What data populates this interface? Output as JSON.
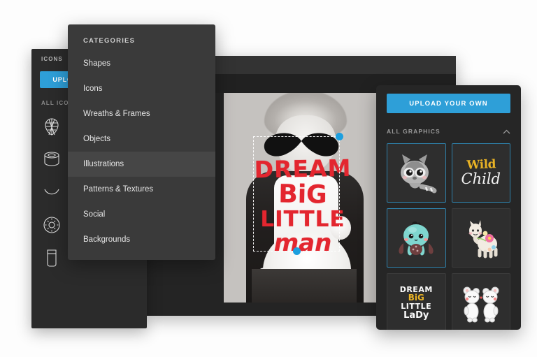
{
  "icons_panel": {
    "title": "ICONS",
    "upload_label": "UPLOAD YOUR OWN",
    "section_label": "ALL ICONS",
    "icons": [
      {
        "name": "pinecone-icon"
      },
      {
        "name": "bread-loaf-icon"
      },
      {
        "name": "cupcake-stand-icon"
      },
      {
        "name": "pretzel-icon"
      },
      {
        "name": "cake-tin-icon"
      },
      {
        "name": "cinnamon-roll-icon"
      },
      {
        "name": "smiling-bun-icon"
      },
      {
        "name": "heart-bun-icon"
      },
      {
        "name": "taco-icon"
      },
      {
        "name": "waffle-icon"
      },
      {
        "name": "donut-icon"
      },
      {
        "name": "bagel-icon"
      },
      {
        "name": "sprinkle-donut-icon"
      },
      {
        "name": "fried-egg-icon"
      },
      {
        "name": "snowflake-icon"
      },
      {
        "name": "garlic-icon"
      },
      {
        "name": "drink-glass-icon"
      }
    ]
  },
  "categories": {
    "title": "CATEGORIES",
    "items": [
      {
        "label": "Shapes",
        "active": false
      },
      {
        "label": "Icons",
        "active": false
      },
      {
        "label": "Wreaths & Frames",
        "active": false
      },
      {
        "label": "Objects",
        "active": false
      },
      {
        "label": "Illustrations",
        "active": true
      },
      {
        "label": "Patterns & Textures",
        "active": false
      },
      {
        "label": "Social",
        "active": false
      },
      {
        "label": "Backgrounds",
        "active": false
      }
    ]
  },
  "graphics_panel": {
    "upload_label": "UPLOAD YOUR OWN",
    "section_label": "ALL GRAPHICS",
    "collapse_icon": "chevron-up-icon",
    "items": [
      {
        "name": "raccoon-graphic",
        "label": "",
        "selected": true
      },
      {
        "name": "wild-child-graphic",
        "label": "Wild Child",
        "line1": "Wild",
        "line2": "Child",
        "selected": true
      },
      {
        "name": "octopus-graphic",
        "label": "",
        "selected": true
      },
      {
        "name": "llama-graphic",
        "label": "",
        "selected": false
      },
      {
        "name": "dream-big-little-lady-graphic",
        "line1": "DREAM",
        "line2": "BiG",
        "line3": "LITTLE",
        "line4": "LaDy",
        "selected": false
      },
      {
        "name": "kissing-bears-graphic",
        "label": "",
        "selected": false
      }
    ]
  },
  "canvas": {
    "overlay_text": {
      "line1": "DREAM",
      "line2": "BiG",
      "line3": "LITTLE",
      "line4": "man"
    },
    "selection": {
      "handle_color": "#1c9fdf"
    }
  },
  "colors": {
    "accent_blue": "#2e9fd8",
    "handle_blue": "#1c9fdf",
    "text_red": "#e3262f",
    "text_gold": "#e8b225",
    "panel_dark": "#2b2b2b",
    "panel_mid": "#3a3a3a",
    "panel_right": "#262626"
  }
}
